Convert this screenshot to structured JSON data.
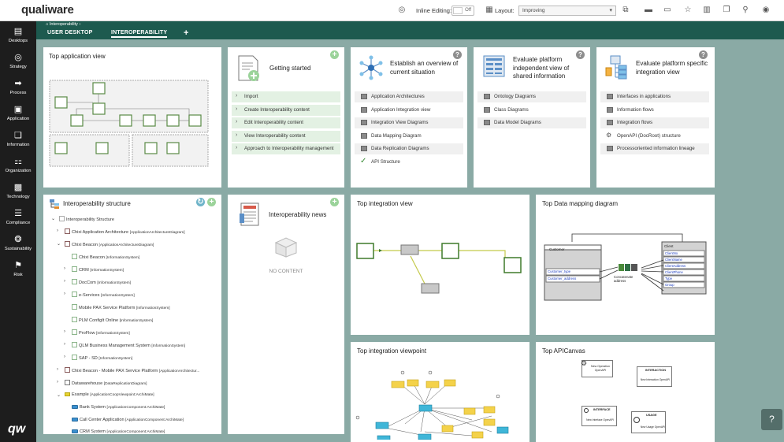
{
  "app": {
    "logo": "qualiware",
    "bottom_logo": "qw"
  },
  "toolbar": {
    "inline_editing_label": "Inline Editing:",
    "inline_editing_state": "Off",
    "layout_label": "Layout:",
    "layout_value": "Improving"
  },
  "sidebar": {
    "items": [
      {
        "label": "Desktops"
      },
      {
        "label": "Strategy"
      },
      {
        "label": "Process"
      },
      {
        "label": "Application"
      },
      {
        "label": "Information"
      },
      {
        "label": "Organization"
      },
      {
        "label": "Technology"
      },
      {
        "label": "Compliance"
      },
      {
        "label": "Sustainability"
      },
      {
        "label": "Risk"
      }
    ]
  },
  "header": {
    "breadcrumb": "Interoperability",
    "tabs": [
      {
        "label": "USER DESKTOP"
      },
      {
        "label": "INTEROPERABILITY"
      }
    ],
    "add_tab": "+"
  },
  "cards": {
    "top_app_view": {
      "title": "Top application view"
    },
    "getting_started": {
      "title": "Getting started",
      "items": [
        {
          "label": "Import"
        },
        {
          "label": "Create Interoperability content"
        },
        {
          "label": "Edit Interoperability content"
        },
        {
          "label": "View Interoperability content"
        },
        {
          "label": "Approach to Interoperability management"
        }
      ]
    },
    "establish": {
      "title": "Establish an overview of current situation",
      "items": [
        {
          "label": "Application Architectures"
        },
        {
          "label": "Application Integration view"
        },
        {
          "label": "Integration View Diagrams"
        },
        {
          "label": "Data Mapping Diagram"
        },
        {
          "label": "Data Replication Diagrams"
        },
        {
          "label": "API Structure"
        }
      ]
    },
    "platform_independent": {
      "title": "Evaluate platform independent view of shared information",
      "items": [
        {
          "label": "Ontology Diagrams"
        },
        {
          "label": "Class Diagrams"
        },
        {
          "label": "Data Model Diagrams"
        }
      ]
    },
    "platform_specific": {
      "title": "Evaluate platform specific integration view",
      "items": [
        {
          "label": "Interfaces in applications"
        },
        {
          "label": "Information flows"
        },
        {
          "label": "Integration flows"
        },
        {
          "label": "OpenAPI (DocRoot) structure"
        },
        {
          "label": "Processoriented information lineage"
        }
      ]
    },
    "structure": {
      "title": "Interoperability structure",
      "root": "Interoperability Structure",
      "rows": [
        {
          "name": "Chixi Application Architecture",
          "type": "[ApplicationArchitectureDiagram]"
        },
        {
          "name": "Chixi Beacon",
          "type": "[ApplicationArchitectureDiagram]"
        },
        {
          "name": "Chixi Beacon",
          "type": "[InformationSystem]"
        },
        {
          "name": "CRM",
          "type": "[InformationSystem]"
        },
        {
          "name": "DocCom",
          "type": "[InformationSystem]"
        },
        {
          "name": "e-Services",
          "type": "[InformationSystem]"
        },
        {
          "name": "Mobile PAX Service Platform",
          "type": "[InformationSystem]"
        },
        {
          "name": "PLM ConfigIt Online",
          "type": "[InformationSystem]"
        },
        {
          "name": "ProFlow",
          "type": "[InformationSystem]"
        },
        {
          "name": "QLM Business Management System",
          "type": "[InformationSystem]"
        },
        {
          "name": "SAP - SD",
          "type": "[InformationSystem]"
        },
        {
          "name": "Chixi Beacon - Mobile PAX Service Platform",
          "type": "[ApplicationArchitectur..."
        },
        {
          "name": "Datawarehouse",
          "type": "[DataReplicationDiagram]"
        },
        {
          "name": "Example",
          "type": "[ApplicationCoopViewpoint:ArchiMate]"
        },
        {
          "name": "Bank System",
          "type": "[ApplicationComponent:ArchiMate]"
        },
        {
          "name": "Call Center Application",
          "type": "[ApplicationComponent:ArchiMate]"
        },
        {
          "name": "CRM System",
          "type": "[ApplicationComponent:ArchiMate]"
        }
      ]
    },
    "news": {
      "title": "Interoperability news",
      "empty": "NO CONTENT"
    },
    "top_integration_view": {
      "title": "Top integration view"
    },
    "top_data_mapping": {
      "title": "Top Data mapping diagram",
      "customer": "Customer",
      "customer_fields": [
        "Customer_type",
        "Customer_address"
      ],
      "concat": "Concatenate address",
      "client": "Client",
      "client_fields": [
        "ClientNo",
        "ClientName",
        "ClientAddress",
        "ClientPhone",
        "Type",
        "Group"
      ]
    },
    "top_integration_viewpoint": {
      "title": "Top integration viewpoint"
    },
    "top_apicanvas": {
      "title": "Top APICanvas",
      "interaction": "INTERACTION",
      "interaction_sub": "New Interaction OpenAPI",
      "interface": "INTERFACE",
      "interface_sub": "New Interface OpenAPI",
      "usage": "USAGE",
      "usage_sub": "New Usage OpenAPI",
      "operation_sub": "New Operation OpenAPI"
    }
  },
  "colors": {
    "sidebar": "#1d1d1d",
    "header": "#1d5a4f",
    "canvas": "#8aaaa5",
    "accent_green": "#9bd39a"
  }
}
